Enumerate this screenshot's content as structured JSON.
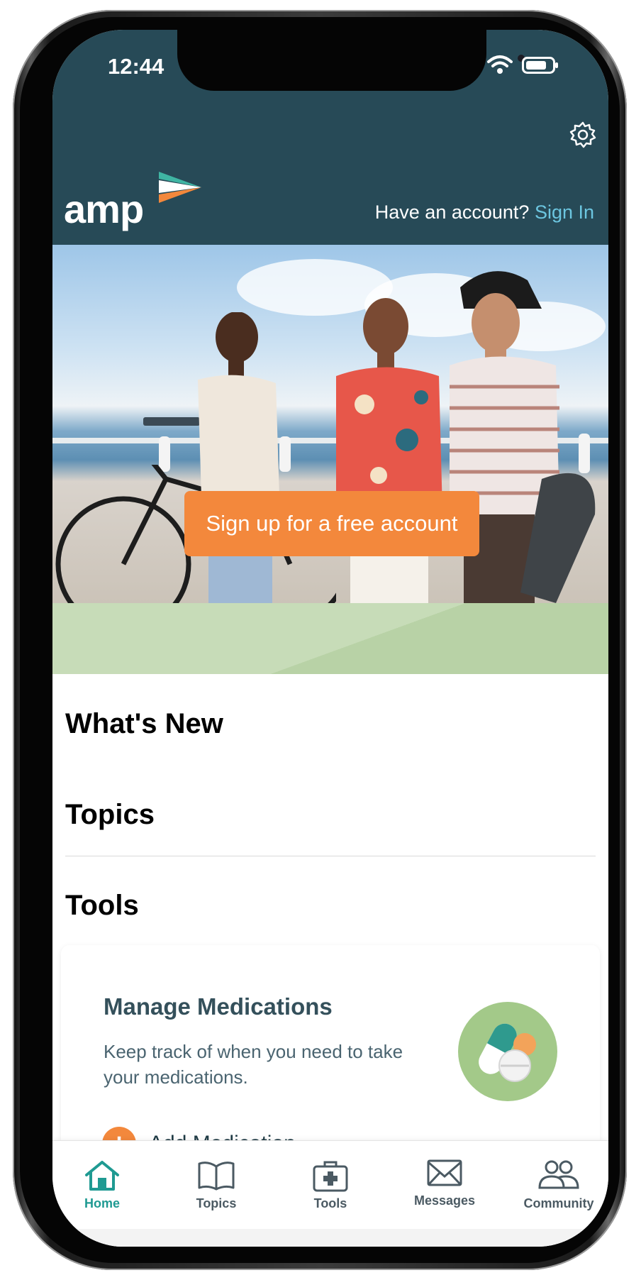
{
  "status_bar": {
    "time": "12:44"
  },
  "header": {
    "logo_text": "amp",
    "account_prompt": "Have an account?",
    "sign_in_label": "Sign In",
    "colors": {
      "background": "#274a57",
      "link": "#6cc6e0"
    }
  },
  "hero": {
    "cta_label": "Sign up for a free account",
    "cta_color": "#f3883c"
  },
  "sections": {
    "whats_new": "What's New",
    "topics": "Topics",
    "tools": "Tools"
  },
  "tool_card": {
    "title": "Manage Medications",
    "description": "Keep track of when you need to take your medications.",
    "action_label": "Add Medication"
  },
  "tabbar": {
    "items": [
      {
        "label": "Home",
        "icon": "home-icon",
        "active": true
      },
      {
        "label": "Topics",
        "icon": "book-icon",
        "active": false
      },
      {
        "label": "Tools",
        "icon": "first-aid-kit-icon",
        "active": false
      },
      {
        "label": "Messages",
        "icon": "envelope-icon",
        "active": false
      },
      {
        "label": "Community",
        "icon": "people-icon",
        "active": false
      }
    ],
    "active_color": "#1f9a92"
  }
}
